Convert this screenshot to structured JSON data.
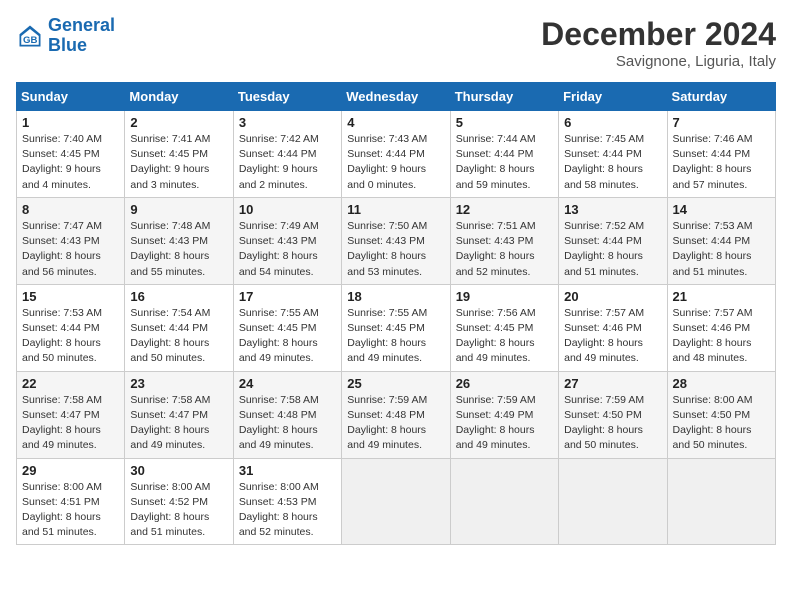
{
  "header": {
    "logo_line1": "General",
    "logo_line2": "Blue",
    "month": "December 2024",
    "location": "Savignone, Liguria, Italy"
  },
  "days_of_week": [
    "Sunday",
    "Monday",
    "Tuesday",
    "Wednesday",
    "Thursday",
    "Friday",
    "Saturday"
  ],
  "weeks": [
    [
      {
        "day": "1",
        "info": "Sunrise: 7:40 AM\nSunset: 4:45 PM\nDaylight: 9 hours\nand 4 minutes."
      },
      {
        "day": "2",
        "info": "Sunrise: 7:41 AM\nSunset: 4:45 PM\nDaylight: 9 hours\nand 3 minutes."
      },
      {
        "day": "3",
        "info": "Sunrise: 7:42 AM\nSunset: 4:44 PM\nDaylight: 9 hours\nand 2 minutes."
      },
      {
        "day": "4",
        "info": "Sunrise: 7:43 AM\nSunset: 4:44 PM\nDaylight: 9 hours\nand 0 minutes."
      },
      {
        "day": "5",
        "info": "Sunrise: 7:44 AM\nSunset: 4:44 PM\nDaylight: 8 hours\nand 59 minutes."
      },
      {
        "day": "6",
        "info": "Sunrise: 7:45 AM\nSunset: 4:44 PM\nDaylight: 8 hours\nand 58 minutes."
      },
      {
        "day": "7",
        "info": "Sunrise: 7:46 AM\nSunset: 4:44 PM\nDaylight: 8 hours\nand 57 minutes."
      }
    ],
    [
      {
        "day": "8",
        "info": "Sunrise: 7:47 AM\nSunset: 4:43 PM\nDaylight: 8 hours\nand 56 minutes."
      },
      {
        "day": "9",
        "info": "Sunrise: 7:48 AM\nSunset: 4:43 PM\nDaylight: 8 hours\nand 55 minutes."
      },
      {
        "day": "10",
        "info": "Sunrise: 7:49 AM\nSunset: 4:43 PM\nDaylight: 8 hours\nand 54 minutes."
      },
      {
        "day": "11",
        "info": "Sunrise: 7:50 AM\nSunset: 4:43 PM\nDaylight: 8 hours\nand 53 minutes."
      },
      {
        "day": "12",
        "info": "Sunrise: 7:51 AM\nSunset: 4:43 PM\nDaylight: 8 hours\nand 52 minutes."
      },
      {
        "day": "13",
        "info": "Sunrise: 7:52 AM\nSunset: 4:44 PM\nDaylight: 8 hours\nand 51 minutes."
      },
      {
        "day": "14",
        "info": "Sunrise: 7:53 AM\nSunset: 4:44 PM\nDaylight: 8 hours\nand 51 minutes."
      }
    ],
    [
      {
        "day": "15",
        "info": "Sunrise: 7:53 AM\nSunset: 4:44 PM\nDaylight: 8 hours\nand 50 minutes."
      },
      {
        "day": "16",
        "info": "Sunrise: 7:54 AM\nSunset: 4:44 PM\nDaylight: 8 hours\nand 50 minutes."
      },
      {
        "day": "17",
        "info": "Sunrise: 7:55 AM\nSunset: 4:45 PM\nDaylight: 8 hours\nand 49 minutes."
      },
      {
        "day": "18",
        "info": "Sunrise: 7:55 AM\nSunset: 4:45 PM\nDaylight: 8 hours\nand 49 minutes."
      },
      {
        "day": "19",
        "info": "Sunrise: 7:56 AM\nSunset: 4:45 PM\nDaylight: 8 hours\nand 49 minutes."
      },
      {
        "day": "20",
        "info": "Sunrise: 7:57 AM\nSunset: 4:46 PM\nDaylight: 8 hours\nand 49 minutes."
      },
      {
        "day": "21",
        "info": "Sunrise: 7:57 AM\nSunset: 4:46 PM\nDaylight: 8 hours\nand 48 minutes."
      }
    ],
    [
      {
        "day": "22",
        "info": "Sunrise: 7:58 AM\nSunset: 4:47 PM\nDaylight: 8 hours\nand 49 minutes."
      },
      {
        "day": "23",
        "info": "Sunrise: 7:58 AM\nSunset: 4:47 PM\nDaylight: 8 hours\nand 49 minutes."
      },
      {
        "day": "24",
        "info": "Sunrise: 7:58 AM\nSunset: 4:48 PM\nDaylight: 8 hours\nand 49 minutes."
      },
      {
        "day": "25",
        "info": "Sunrise: 7:59 AM\nSunset: 4:48 PM\nDaylight: 8 hours\nand 49 minutes."
      },
      {
        "day": "26",
        "info": "Sunrise: 7:59 AM\nSunset: 4:49 PM\nDaylight: 8 hours\nand 49 minutes."
      },
      {
        "day": "27",
        "info": "Sunrise: 7:59 AM\nSunset: 4:50 PM\nDaylight: 8 hours\nand 50 minutes."
      },
      {
        "day": "28",
        "info": "Sunrise: 8:00 AM\nSunset: 4:50 PM\nDaylight: 8 hours\nand 50 minutes."
      }
    ],
    [
      {
        "day": "29",
        "info": "Sunrise: 8:00 AM\nSunset: 4:51 PM\nDaylight: 8 hours\nand 51 minutes."
      },
      {
        "day": "30",
        "info": "Sunrise: 8:00 AM\nSunset: 4:52 PM\nDaylight: 8 hours\nand 51 minutes."
      },
      {
        "day": "31",
        "info": "Sunrise: 8:00 AM\nSunset: 4:53 PM\nDaylight: 8 hours\nand 52 minutes."
      },
      {
        "day": "",
        "info": ""
      },
      {
        "day": "",
        "info": ""
      },
      {
        "day": "",
        "info": ""
      },
      {
        "day": "",
        "info": ""
      }
    ]
  ]
}
